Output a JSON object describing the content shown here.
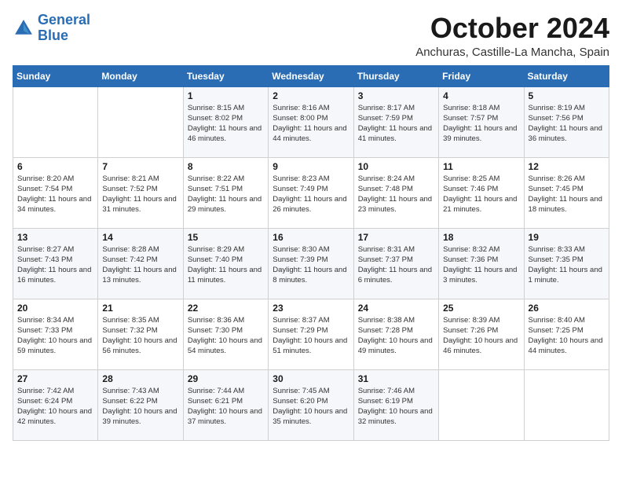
{
  "logo": {
    "text_general": "General",
    "text_blue": "Blue"
  },
  "header": {
    "month": "October 2024",
    "location": "Anchuras, Castille-La Mancha, Spain"
  },
  "days_of_week": [
    "Sunday",
    "Monday",
    "Tuesday",
    "Wednesday",
    "Thursday",
    "Friday",
    "Saturday"
  ],
  "weeks": [
    [
      {
        "day": "",
        "info": ""
      },
      {
        "day": "",
        "info": ""
      },
      {
        "day": "1",
        "info": "Sunrise: 8:15 AM\nSunset: 8:02 PM\nDaylight: 11 hours and 46 minutes."
      },
      {
        "day": "2",
        "info": "Sunrise: 8:16 AM\nSunset: 8:00 PM\nDaylight: 11 hours and 44 minutes."
      },
      {
        "day": "3",
        "info": "Sunrise: 8:17 AM\nSunset: 7:59 PM\nDaylight: 11 hours and 41 minutes."
      },
      {
        "day": "4",
        "info": "Sunrise: 8:18 AM\nSunset: 7:57 PM\nDaylight: 11 hours and 39 minutes."
      },
      {
        "day": "5",
        "info": "Sunrise: 8:19 AM\nSunset: 7:56 PM\nDaylight: 11 hours and 36 minutes."
      }
    ],
    [
      {
        "day": "6",
        "info": "Sunrise: 8:20 AM\nSunset: 7:54 PM\nDaylight: 11 hours and 34 minutes."
      },
      {
        "day": "7",
        "info": "Sunrise: 8:21 AM\nSunset: 7:52 PM\nDaylight: 11 hours and 31 minutes."
      },
      {
        "day": "8",
        "info": "Sunrise: 8:22 AM\nSunset: 7:51 PM\nDaylight: 11 hours and 29 minutes."
      },
      {
        "day": "9",
        "info": "Sunrise: 8:23 AM\nSunset: 7:49 PM\nDaylight: 11 hours and 26 minutes."
      },
      {
        "day": "10",
        "info": "Sunrise: 8:24 AM\nSunset: 7:48 PM\nDaylight: 11 hours and 23 minutes."
      },
      {
        "day": "11",
        "info": "Sunrise: 8:25 AM\nSunset: 7:46 PM\nDaylight: 11 hours and 21 minutes."
      },
      {
        "day": "12",
        "info": "Sunrise: 8:26 AM\nSunset: 7:45 PM\nDaylight: 11 hours and 18 minutes."
      }
    ],
    [
      {
        "day": "13",
        "info": "Sunrise: 8:27 AM\nSunset: 7:43 PM\nDaylight: 11 hours and 16 minutes."
      },
      {
        "day": "14",
        "info": "Sunrise: 8:28 AM\nSunset: 7:42 PM\nDaylight: 11 hours and 13 minutes."
      },
      {
        "day": "15",
        "info": "Sunrise: 8:29 AM\nSunset: 7:40 PM\nDaylight: 11 hours and 11 minutes."
      },
      {
        "day": "16",
        "info": "Sunrise: 8:30 AM\nSunset: 7:39 PM\nDaylight: 11 hours and 8 minutes."
      },
      {
        "day": "17",
        "info": "Sunrise: 8:31 AM\nSunset: 7:37 PM\nDaylight: 11 hours and 6 minutes."
      },
      {
        "day": "18",
        "info": "Sunrise: 8:32 AM\nSunset: 7:36 PM\nDaylight: 11 hours and 3 minutes."
      },
      {
        "day": "19",
        "info": "Sunrise: 8:33 AM\nSunset: 7:35 PM\nDaylight: 11 hours and 1 minute."
      }
    ],
    [
      {
        "day": "20",
        "info": "Sunrise: 8:34 AM\nSunset: 7:33 PM\nDaylight: 10 hours and 59 minutes."
      },
      {
        "day": "21",
        "info": "Sunrise: 8:35 AM\nSunset: 7:32 PM\nDaylight: 10 hours and 56 minutes."
      },
      {
        "day": "22",
        "info": "Sunrise: 8:36 AM\nSunset: 7:30 PM\nDaylight: 10 hours and 54 minutes."
      },
      {
        "day": "23",
        "info": "Sunrise: 8:37 AM\nSunset: 7:29 PM\nDaylight: 10 hours and 51 minutes."
      },
      {
        "day": "24",
        "info": "Sunrise: 8:38 AM\nSunset: 7:28 PM\nDaylight: 10 hours and 49 minutes."
      },
      {
        "day": "25",
        "info": "Sunrise: 8:39 AM\nSunset: 7:26 PM\nDaylight: 10 hours and 46 minutes."
      },
      {
        "day": "26",
        "info": "Sunrise: 8:40 AM\nSunset: 7:25 PM\nDaylight: 10 hours and 44 minutes."
      }
    ],
    [
      {
        "day": "27",
        "info": "Sunrise: 7:42 AM\nSunset: 6:24 PM\nDaylight: 10 hours and 42 minutes."
      },
      {
        "day": "28",
        "info": "Sunrise: 7:43 AM\nSunset: 6:22 PM\nDaylight: 10 hours and 39 minutes."
      },
      {
        "day": "29",
        "info": "Sunrise: 7:44 AM\nSunset: 6:21 PM\nDaylight: 10 hours and 37 minutes."
      },
      {
        "day": "30",
        "info": "Sunrise: 7:45 AM\nSunset: 6:20 PM\nDaylight: 10 hours and 35 minutes."
      },
      {
        "day": "31",
        "info": "Sunrise: 7:46 AM\nSunset: 6:19 PM\nDaylight: 10 hours and 32 minutes."
      },
      {
        "day": "",
        "info": ""
      },
      {
        "day": "",
        "info": ""
      }
    ]
  ]
}
